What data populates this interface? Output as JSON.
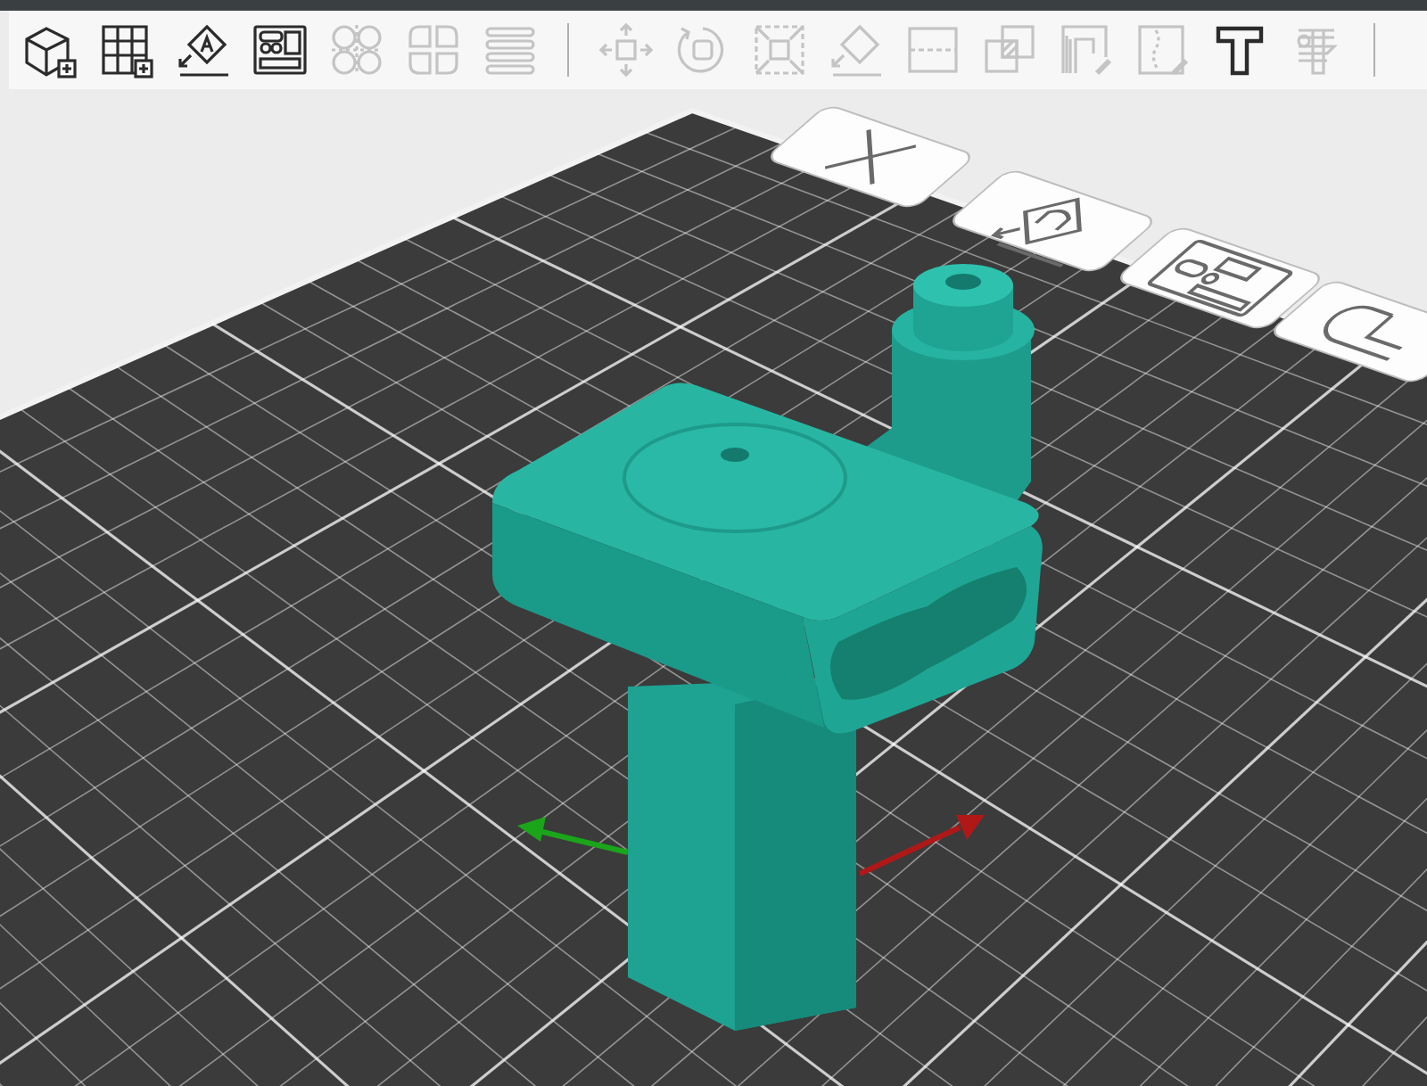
{
  "toolbar": {
    "buttons": [
      {
        "kind": "add",
        "disabled": false
      },
      {
        "kind": "add-plate",
        "disabled": false
      },
      {
        "kind": "orient",
        "disabled": false
      },
      {
        "kind": "arrange",
        "disabled": false
      },
      {
        "kind": "split-objects",
        "disabled": true
      },
      {
        "kind": "split-parts",
        "disabled": true
      },
      {
        "kind": "layers",
        "disabled": true
      },
      {
        "kind": "separator"
      },
      {
        "kind": "move",
        "disabled": true
      },
      {
        "kind": "rotate",
        "disabled": true
      },
      {
        "kind": "scale",
        "disabled": true
      },
      {
        "kind": "lay-on-face",
        "disabled": true
      },
      {
        "kind": "cut",
        "disabled": true
      },
      {
        "kind": "boolean",
        "disabled": true
      },
      {
        "kind": "support-paint",
        "disabled": true
      },
      {
        "kind": "seam-paint",
        "disabled": true
      },
      {
        "kind": "text",
        "disabled": false
      },
      {
        "kind": "measure",
        "disabled": true
      },
      {
        "kind": "separator"
      }
    ]
  },
  "plate": {
    "buttons": [
      {
        "kind": "delete",
        "disabled": false
      },
      {
        "kind": "orient",
        "disabled": false
      },
      {
        "kind": "arrange",
        "disabled": false
      },
      {
        "kind": "lock",
        "disabled": false
      }
    ]
  }
}
